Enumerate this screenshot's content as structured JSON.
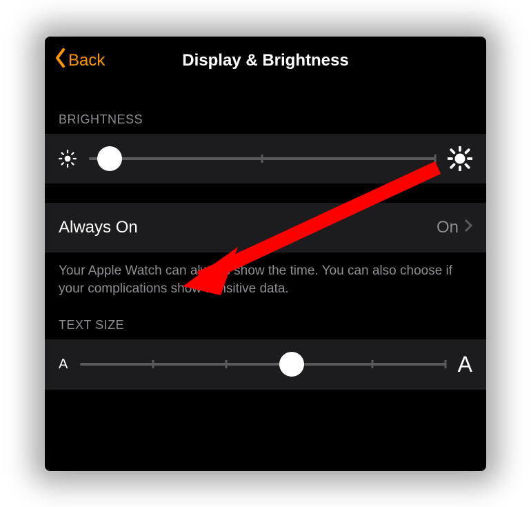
{
  "nav": {
    "back_label": "Back",
    "title": "Display & Brightness"
  },
  "brightness": {
    "header": "BRIGHTNESS",
    "min_icon": "sun-small-icon",
    "max_icon": "sun-large-icon",
    "value_percent": 6,
    "ticks": [
      0,
      50,
      100
    ]
  },
  "always_on": {
    "label": "Always On",
    "value": "On",
    "footer": "Your Apple Watch can always show the time. You can also choose if your complications show sensitive data."
  },
  "text_size": {
    "header": "TEXT SIZE",
    "min_label": "A",
    "max_label": "A",
    "value_percent": 58,
    "ticks": [
      0,
      20,
      40,
      60,
      80,
      100
    ]
  },
  "annotation": {
    "type": "pointer-arrow",
    "color": "#ff0000",
    "target": "always-on-row"
  }
}
